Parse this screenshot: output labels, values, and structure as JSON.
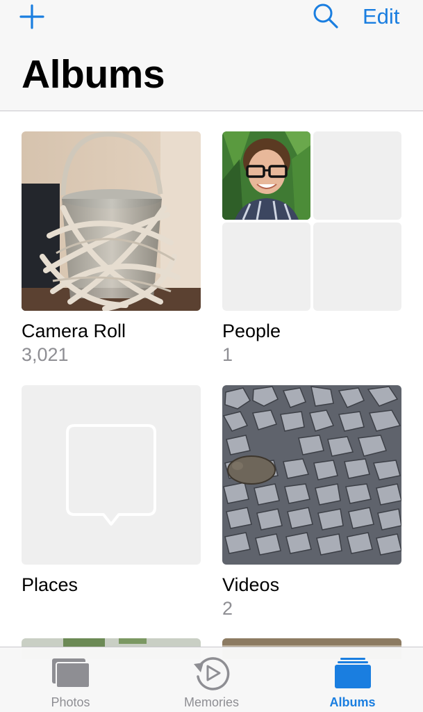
{
  "header": {
    "title": "Albums",
    "edit_label": "Edit"
  },
  "albums": [
    {
      "name": "Camera Roll",
      "count": "3,021"
    },
    {
      "name": "People",
      "count": "1"
    },
    {
      "name": "Places",
      "count": ""
    },
    {
      "name": "Videos",
      "count": "2"
    }
  ],
  "tabs": [
    {
      "label": "Photos",
      "icon": "photos-stack-icon",
      "active": false
    },
    {
      "label": "Memories",
      "icon": "memories-replay-icon",
      "active": false
    },
    {
      "label": "Albums",
      "icon": "albums-stack-icon",
      "active": true
    }
  ],
  "colors": {
    "accent": "#1a7ee0",
    "secondary_text": "#8e8e93",
    "placeholder_bg": "#efefef"
  }
}
